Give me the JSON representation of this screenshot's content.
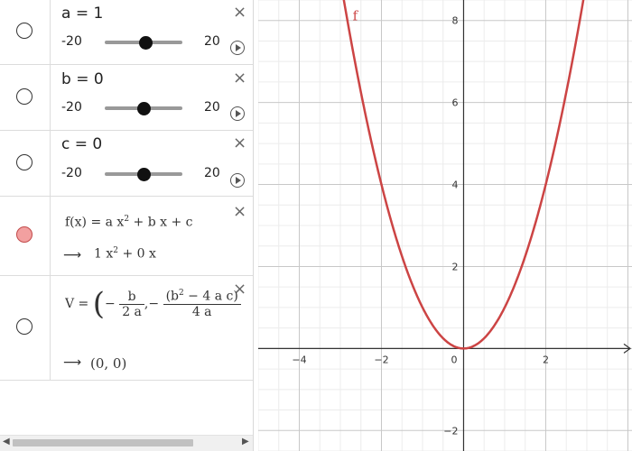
{
  "algebra": {
    "sliders": [
      {
        "definition": "a = 1",
        "min": "-20",
        "max": "20",
        "value": 1,
        "range": [
          -20,
          20
        ]
      },
      {
        "definition": "b = 0",
        "min": "-20",
        "max": "20",
        "value": 0,
        "range": [
          -20,
          20
        ]
      },
      {
        "definition": "c = 0",
        "min": "-20",
        "max": "20",
        "value": 0,
        "range": [
          -20,
          20
        ]
      }
    ],
    "function": {
      "name": "f(x)",
      "definition_parts": {
        "lhs": "f(x) = a x",
        "exp": "2",
        "rest": " + b x + c"
      },
      "value_parts": {
        "lhs": "1 x",
        "exp": "2",
        "rest": " + 0 x"
      },
      "color": "#cc4444"
    },
    "vertex": {
      "lhs": "V =",
      "b": "b",
      "two_a": "2 a",
      "num_open": "(b",
      "num_exp": "2",
      "num_rest": " − 4 a c)",
      "four_a": "4 a",
      "minus": "−",
      "comma": ",",
      "value": "(0, 0)"
    },
    "arrow": "⟶",
    "close_glyph": "×"
  },
  "graph": {
    "curve_label": "f",
    "curve_color": "#cc4444",
    "x_ticks": [
      "−4",
      "−2",
      "0",
      "2"
    ],
    "y_ticks": [
      "8",
      "6",
      "4",
      "2",
      "−2"
    ],
    "function": {
      "a": 1,
      "b": 0,
      "c": 0
    },
    "xlim": [
      -5,
      4.1
    ],
    "ylim": [
      -2.5,
      8.5
    ]
  }
}
